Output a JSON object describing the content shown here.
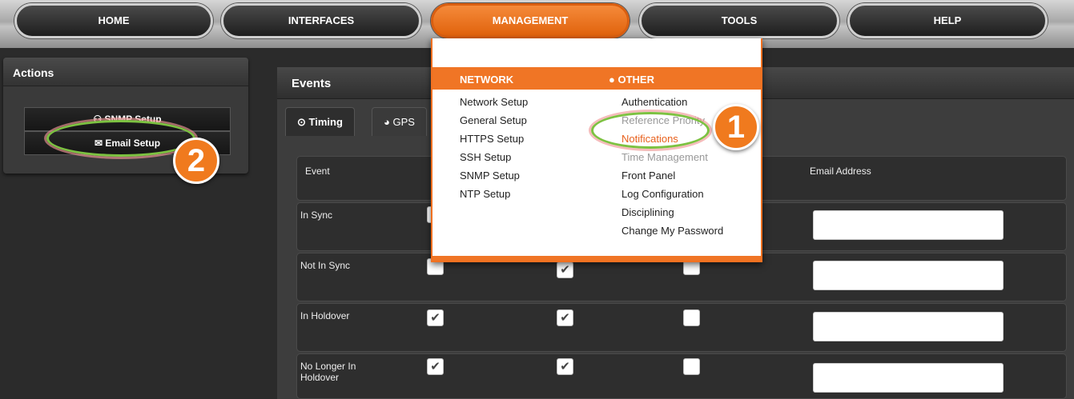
{
  "nav": {
    "home": "HOME",
    "interfaces": "INTERFACES",
    "management": "MANAGEMENT",
    "tools": "TOOLS",
    "help": "HELP"
  },
  "sidebar": {
    "title": "Actions",
    "snmp_setup": "SNMP Setup",
    "email_setup": "Email Setup"
  },
  "panel": {
    "title": "Events",
    "tabs": {
      "timing": "Timing",
      "gps": "GPS"
    },
    "columns": {
      "event": "Event",
      "email_address": "Email Address"
    },
    "rows": [
      {
        "label": "In Sync",
        "checks": [
          false,
          false,
          false
        ],
        "email": ""
      },
      {
        "label": "Not In Sync",
        "checks": [
          false,
          true,
          false
        ],
        "email": ""
      },
      {
        "label": "In Holdover",
        "checks": [
          true,
          true,
          false
        ],
        "email": ""
      },
      {
        "label": "No Longer In Holdover",
        "checks": [
          true,
          true,
          false
        ],
        "email": ""
      }
    ]
  },
  "dropdown": {
    "network_header": "NETWORK",
    "other_header": "OTHER",
    "network_items": [
      "Network Setup",
      "General Setup",
      "HTTPS Setup",
      "SSH Setup",
      "SNMP Setup",
      "NTP Setup"
    ],
    "other_items": [
      "Authentication",
      "Reference Priority",
      "Notifications",
      "Time Management",
      "Front Panel",
      "Log Configuration",
      "Disciplining",
      "Change My Password"
    ]
  },
  "callouts": {
    "one": "1",
    "two": "2"
  },
  "colors": {
    "accent": "#f07525",
    "highlight_ring": "#7cc241",
    "selected_link": "#e8601c"
  },
  "icons": {
    "snmp": "network-icon",
    "email": "envelope-icon",
    "timing": "clock-icon",
    "gps": "globe-icon",
    "checked": "check-icon"
  }
}
